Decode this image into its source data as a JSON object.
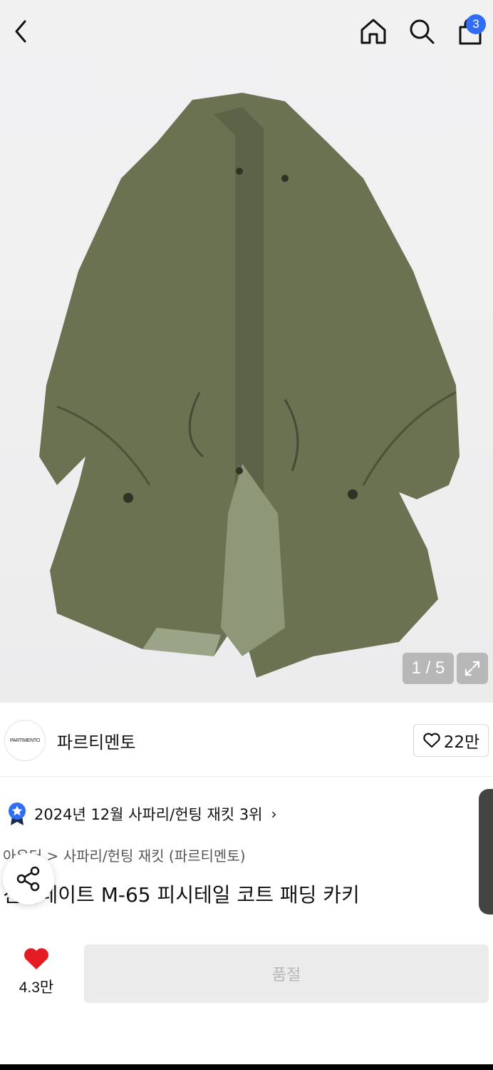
{
  "header": {
    "back_icon": "chevron-left-icon",
    "home_icon": "home-icon",
    "search_icon": "search-icon",
    "cart_icon": "shopping-bag-icon",
    "cart_count": "3"
  },
  "gallery": {
    "counter": "1 / 5",
    "expand_icon": "expand-icon"
  },
  "brand": {
    "logo_text": "PARTIMENTO",
    "name": "파르티멘토",
    "like_count": "22만"
  },
  "ranking": {
    "text": "2024년 12월 사파리/헌팅 재킷 3위",
    "arrow": "›"
  },
  "product": {
    "breadcrumb": "아우터 > 사파리/헌팅 재킷 (파르티멘토)",
    "title": "신슐레이트 M-65 피시테일 코트 패딩 카키"
  },
  "bottom": {
    "favorite_count": "4.3만",
    "buy_label": "품절"
  },
  "colors": {
    "accent": "#2f6df6",
    "heart": "#e51c23",
    "coat": "#6b7252"
  }
}
